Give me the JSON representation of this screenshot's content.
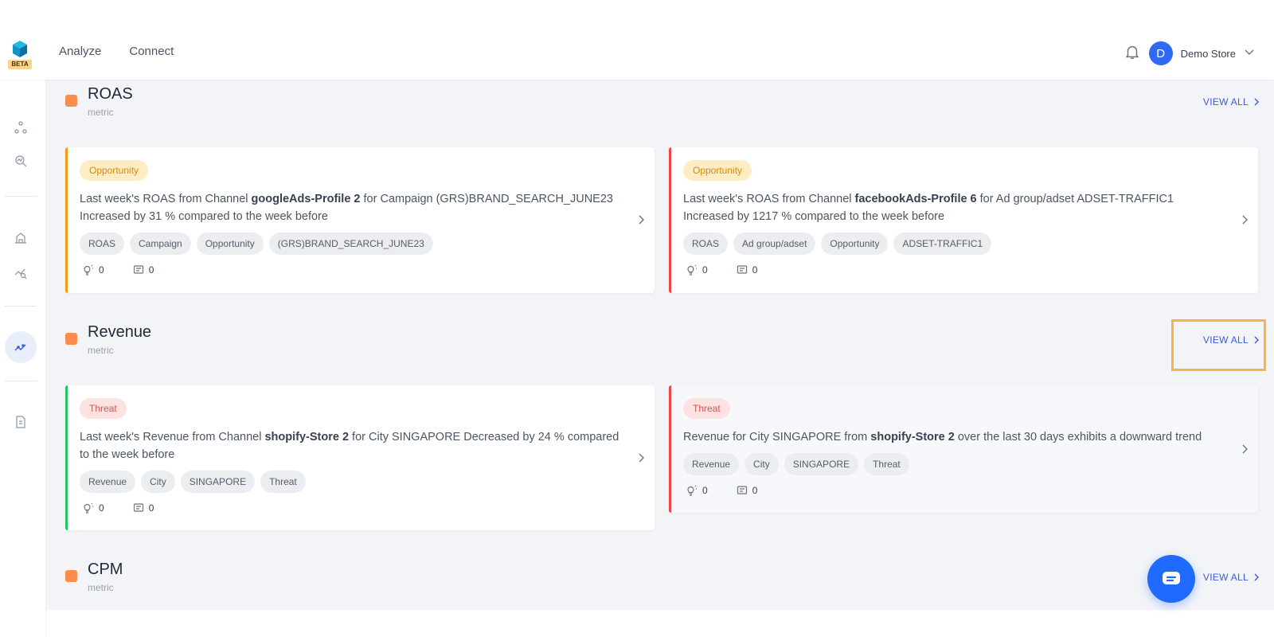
{
  "app": {
    "badge": "BETA"
  },
  "nav": {
    "analyze": "Analyze",
    "connect": "Connect"
  },
  "user": {
    "initial": "D",
    "store_name": "Demo Store"
  },
  "colors": {
    "accent": "#3b5bdb",
    "section_marker": "#fb8c4e",
    "opportunity_bar": "#f59e0b",
    "threat_bar_green": "#22c55e",
    "threat_bar_red": "#ef4444"
  },
  "sections": [
    {
      "title": "ROAS",
      "subtitle": "metric",
      "view_all": "VIEW ALL",
      "cards": [
        {
          "badge": "Opportunity",
          "pre": "Last week's ROAS from Channel ",
          "bold": "googleAds-Profile 2",
          "post": " for Campaign (GRS)BRAND_SEARCH_JUNE23 Increased by 31 % compared to the week before",
          "tags": [
            "ROAS",
            "Campaign",
            "Opportunity",
            "(GRS)BRAND_SEARCH_JUNE23"
          ],
          "likes": "0",
          "comments": "0"
        },
        {
          "badge": "Opportunity",
          "pre": "Last week's ROAS from Channel ",
          "bold": "facebookAds-Profile 6",
          "post": " for Ad group/adset ADSET-TRAFFIC1 Increased by 1217 % compared to the week before",
          "tags": [
            "ROAS",
            "Ad group/adset",
            "Opportunity",
            "ADSET-TRAFFIC1"
          ],
          "likes": "0",
          "comments": "0"
        }
      ]
    },
    {
      "title": "Revenue",
      "subtitle": "metric",
      "view_all": "VIEW ALL",
      "cards": [
        {
          "badge": "Threat",
          "pre": "Last week's Revenue from Channel ",
          "bold": "shopify-Store 2",
          "post": " for City SINGAPORE Decreased by 24 % compared to the week before",
          "tags": [
            "Revenue",
            "City",
            "SINGAPORE",
            "Threat"
          ],
          "likes": "0",
          "comments": "0"
        },
        {
          "badge": "Threat",
          "pre": "Revenue for City SINGAPORE from ",
          "bold": "shopify-Store 2",
          "post": " over the last 30 days exhibits a downward trend",
          "tags": [
            "Revenue",
            "City",
            "SINGAPORE",
            "Threat"
          ],
          "likes": "0",
          "comments": "0"
        }
      ]
    },
    {
      "title": "CPM",
      "subtitle": "metric",
      "view_all": "VIEW ALL",
      "cards": []
    }
  ]
}
